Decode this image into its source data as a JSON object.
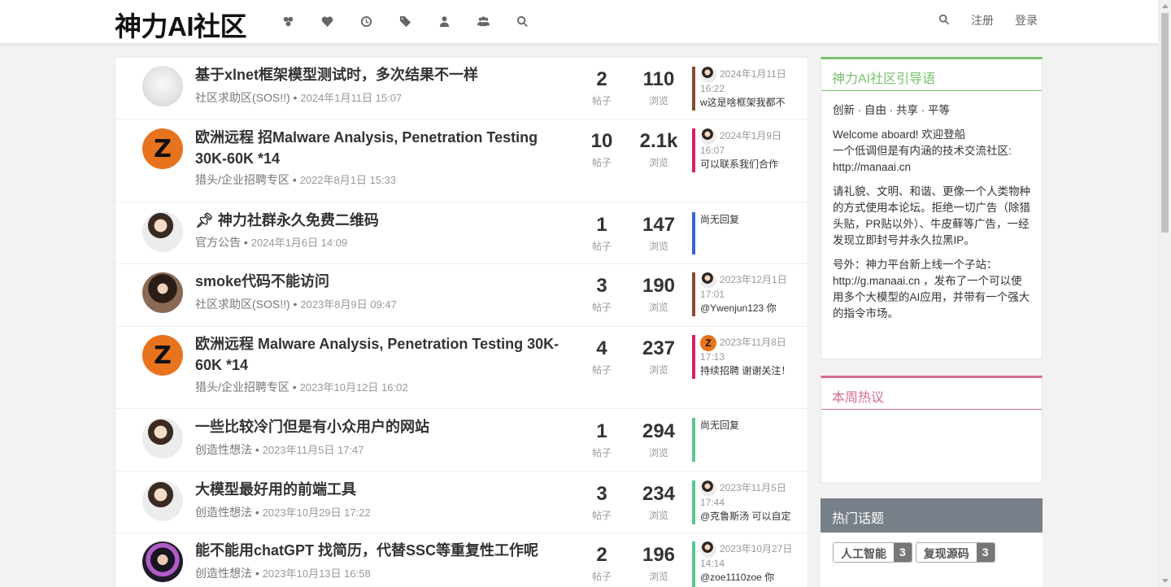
{
  "nav": {
    "brand": "神力AI社区",
    "icons": [
      "categories-icon",
      "popular-icon",
      "recent-icon",
      "tags-icon",
      "user-icon",
      "groups-icon",
      "search-icon"
    ],
    "register": "注册",
    "login": "登录"
  },
  "topics": [
    {
      "title": "基于xlnet框架模型测试时，多次结果不一样",
      "category": "社区求助区(SOS!!)",
      "time": "2024年1月11日 15:07",
      "posts": "2",
      "posts_label": "帖子",
      "views": "110",
      "views_label": "浏览",
      "teaser_date": "2024年1月11日 16:22",
      "teaser_text": "w这是啥框架我都不",
      "avatar": "dog",
      "teaser_color": "#8b4a32"
    },
    {
      "title": "欧洲远程 招Malware Analysis, Penetration Testing 30K-60K *14",
      "category": "猎头/企业招聘专区",
      "time": "2022年8月1日 15:33",
      "posts": "10",
      "posts_label": "帖子",
      "views": "2.1k",
      "views_label": "浏览",
      "teaser_date": "2024年1月9日 16:07",
      "teaser_text": "可以联系我们合作",
      "avatar": "z",
      "teaser_color": "#e01a6b"
    },
    {
      "title": "神力社群永久免费二维码",
      "category": "官方公告",
      "time": "2024年1月6日 14:09",
      "posts": "1",
      "posts_label": "帖子",
      "views": "147",
      "views_label": "浏览",
      "teaser_none": "尚无回复",
      "avatar": "person",
      "teaser_color": "#3a62d8",
      "pinned": true
    },
    {
      "title": "smoke代码不能访问",
      "category": "社区求助区(SOS!!)",
      "time": "2023年8月9日 09:47",
      "posts": "3",
      "posts_label": "帖子",
      "views": "190",
      "views_label": "浏览",
      "teaser_date": "2023年12月1日 17:01",
      "teaser_text": "@Ywenjun123 你",
      "avatar": "girl",
      "teaser_color": "#8b4a32"
    },
    {
      "title": "欧洲远程 Malware Analysis, Penetration Testing 30K-60K *14",
      "category": "猎头/企业招聘专区",
      "time": "2023年10月12日 16:02",
      "posts": "4",
      "posts_label": "帖子",
      "views": "237",
      "views_label": "浏览",
      "teaser_date": "2023年11月8日 17:13",
      "teaser_text": "持续招聘 谢谢关注！",
      "avatar": "z",
      "teaser_color": "#e01a6b",
      "teaser_avatar": "Z"
    },
    {
      "title": "一些比较冷门但是有小众用户的网站",
      "category": "创造性想法",
      "time": "2023年11月5日 17:47",
      "posts": "1",
      "posts_label": "帖子",
      "views": "294",
      "views_label": "浏览",
      "teaser_none": "尚无回复",
      "avatar": "person",
      "teaser_color": "#5ac88e"
    },
    {
      "title": "大模型最好用的前端工具",
      "category": "创造性想法",
      "time": "2023年10月29日 17:22",
      "posts": "3",
      "posts_label": "帖子",
      "views": "234",
      "views_label": "浏览",
      "teaser_date": "2023年11月5日 17:44",
      "teaser_text": "@克鲁斯汤 可以自定",
      "avatar": "person",
      "teaser_color": "#5ac88e"
    },
    {
      "title": "能不能用chatGPT 找简历，代替SSC等重复性工作呢",
      "category": "创造性想法",
      "time": "2023年10月13日 16:58",
      "posts": "2",
      "posts_label": "帖子",
      "views": "196",
      "views_label": "浏览",
      "teaser_date": "2023年10月27日 14:14",
      "teaser_text": "@zoe1110zoe 你",
      "avatar": "dark",
      "teaser_color": "#5ac88e"
    }
  ],
  "sidebar": {
    "guide_title": "神力AI社区引导语",
    "guide_p1": "创新 · 自由 · 共享 · 平等",
    "guide_p2a": "Welcome aboard! 欢迎登船",
    "guide_p2b": "一个低调但是有内涵的技术交流社区:",
    "guide_p2c": "http://manaai.cn",
    "guide_p3": "请礼貌、文明、和谐、更像一个人类物种的方式使用本论坛。拒绝一切广告（除猎头贴，PR贴以外）、牛皮藓等广告，一经发现立即封号并永久拉黑IP。",
    "guide_p4": "号外：神力平台新上线一个子站：http://g.manaai.cn ，发布了一个可以使用多个大模型的AI应用，并带有一个强大的指令市场。",
    "hot_week_title": "本周热议",
    "hot_tags_title": "热门话题",
    "tags": [
      {
        "name": "人工智能",
        "count": "3"
      },
      {
        "name": "复现源码",
        "count": "3"
      }
    ]
  }
}
